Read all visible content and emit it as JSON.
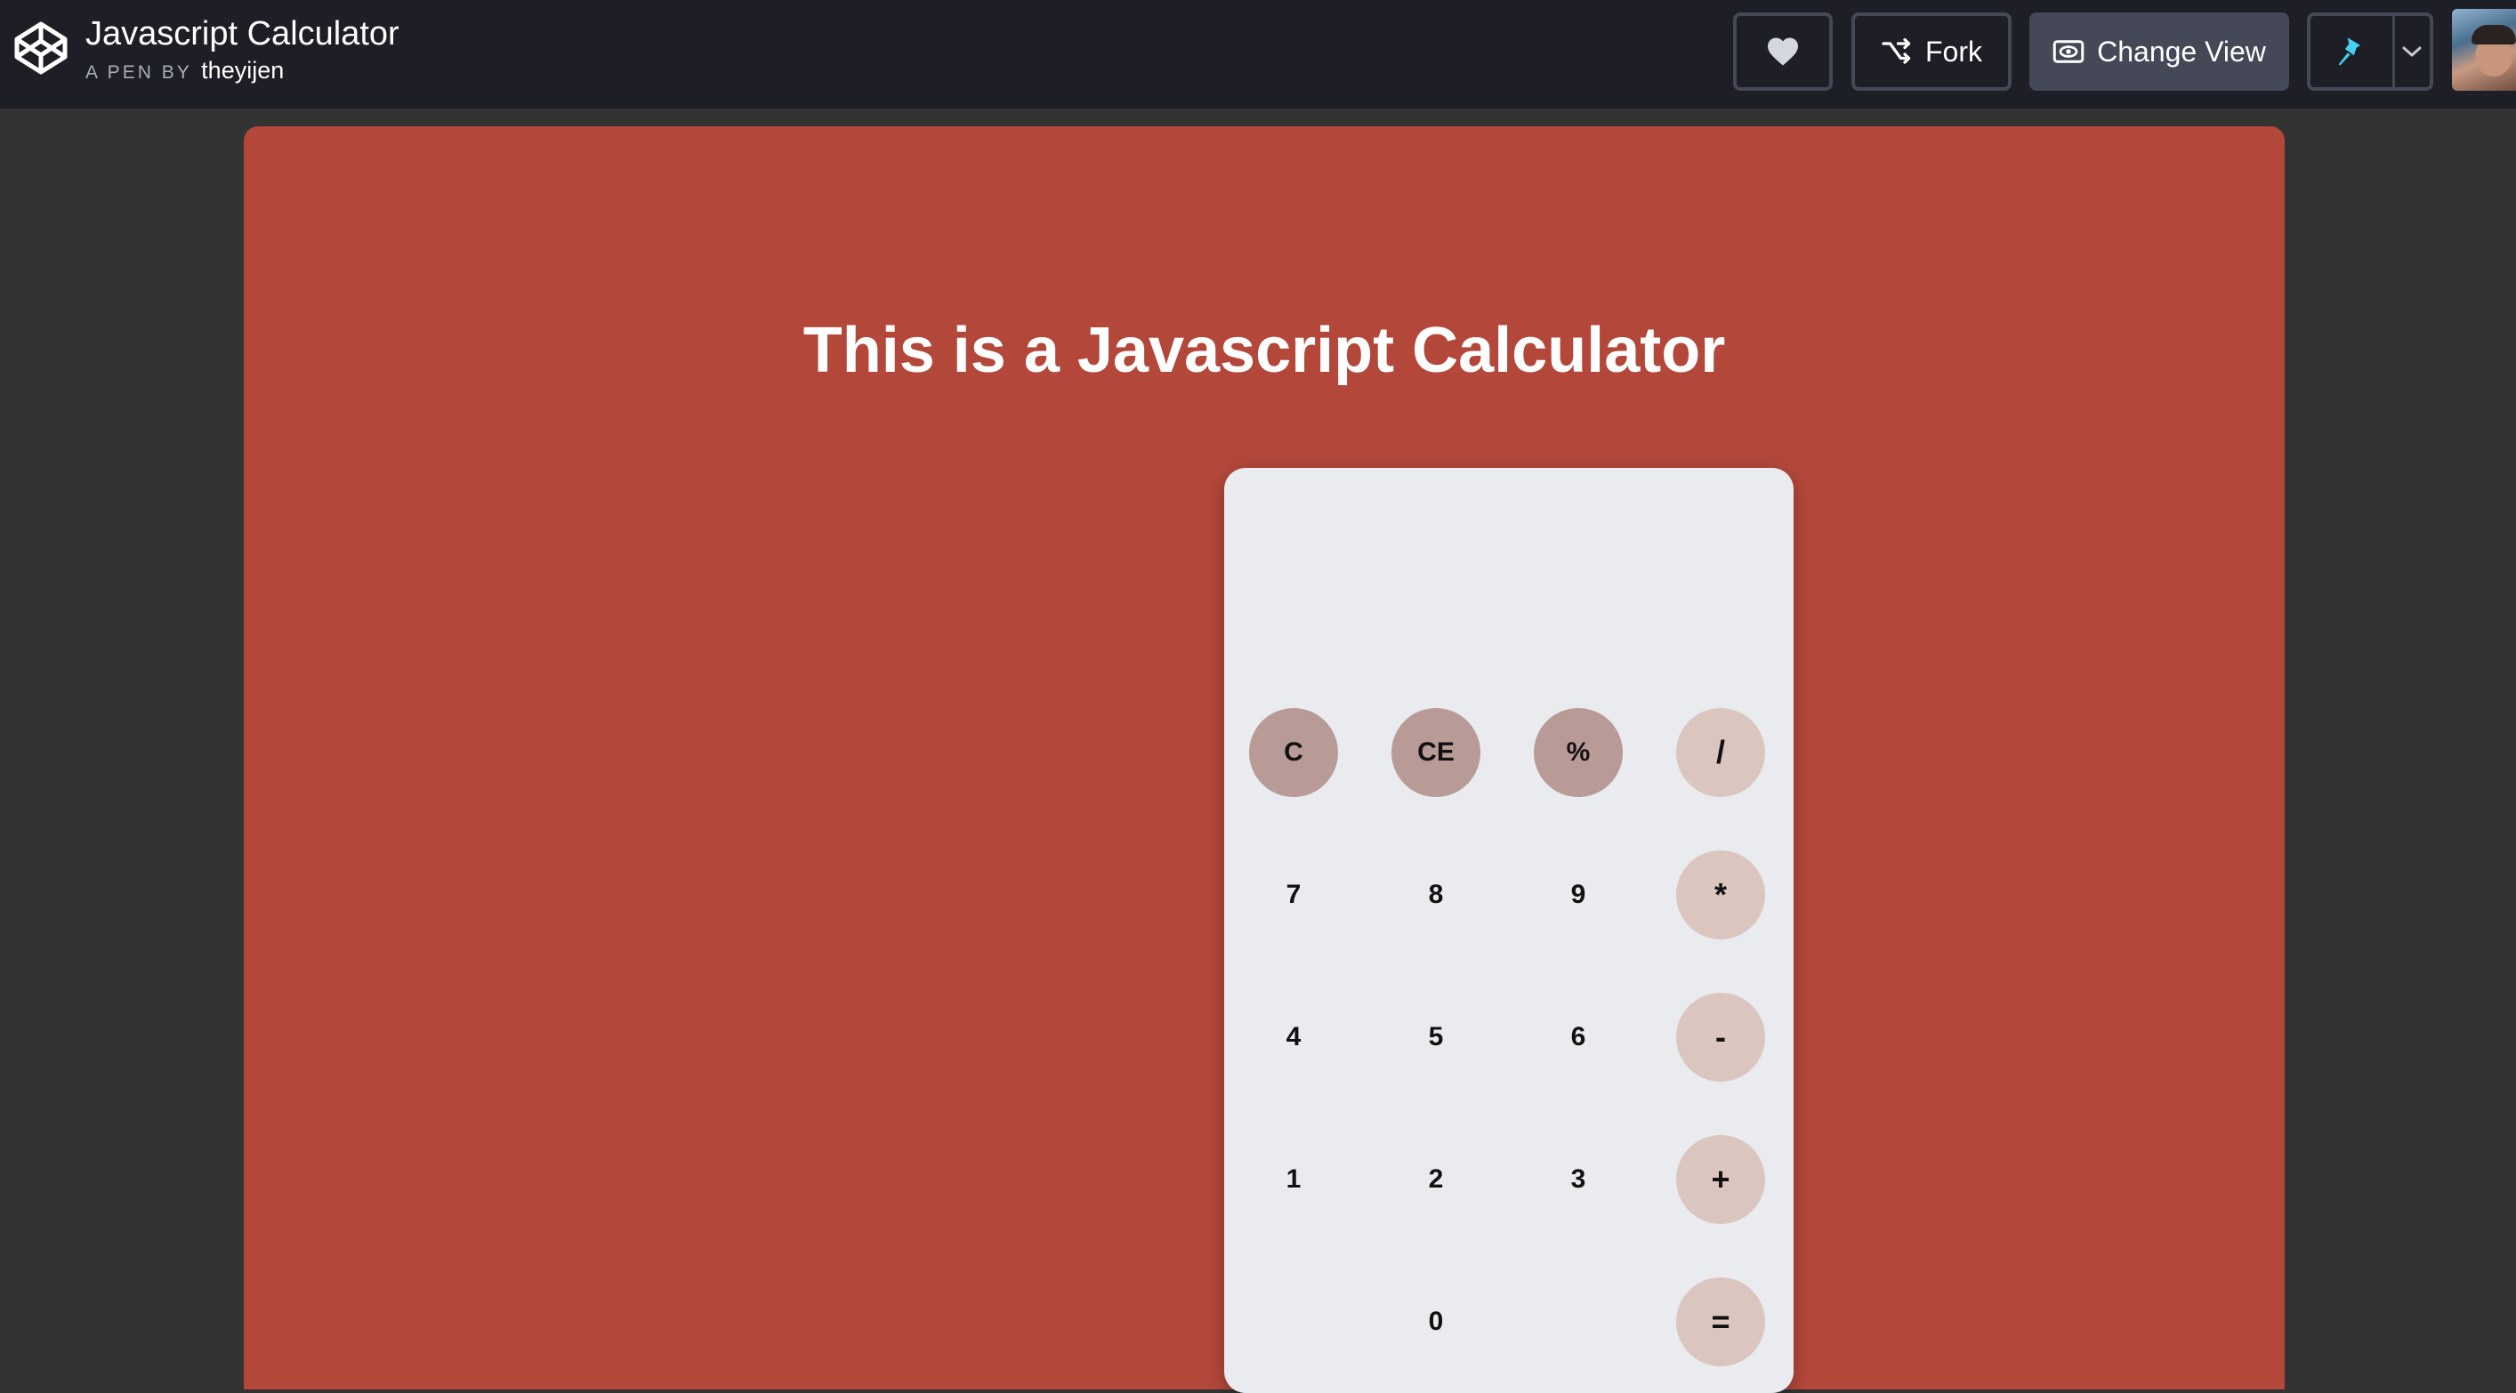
{
  "header": {
    "pen_title": "Javascript Calculator",
    "by_prefix": "A PEN BY",
    "author": "theyijen",
    "logo_icon": "codepen-logo-icon",
    "buttons": {
      "heart_icon": "heart-icon",
      "fork_label": "Fork",
      "fork_icon": "fork-icon",
      "change_view_label": "Change View",
      "change_view_icon": "eye-icon",
      "pin_icon": "pin-icon",
      "dropdown_icon": "chevron-down-icon"
    }
  },
  "preview": {
    "background_color": "#b3473a",
    "headline": "This is a Javascript Calculator"
  },
  "calculator": {
    "display_value": "",
    "keys": {
      "clear": "C",
      "clear_entry": "CE",
      "percent": "%",
      "divide": "/",
      "seven": "7",
      "eight": "8",
      "nine": "9",
      "multiply": "*",
      "four": "4",
      "five": "5",
      "six": "6",
      "subtract": "-",
      "one": "1",
      "two": "2",
      "three": "3",
      "add": "+",
      "zero": "0",
      "equals": "="
    }
  },
  "colors": {
    "topbar": "#1e1f26",
    "page_bg": "#333333",
    "calculator_body": "#e9ebee",
    "function_key": "#b89a96",
    "operator_key": "#dbc6bf",
    "pin_accent": "#47cff4"
  }
}
